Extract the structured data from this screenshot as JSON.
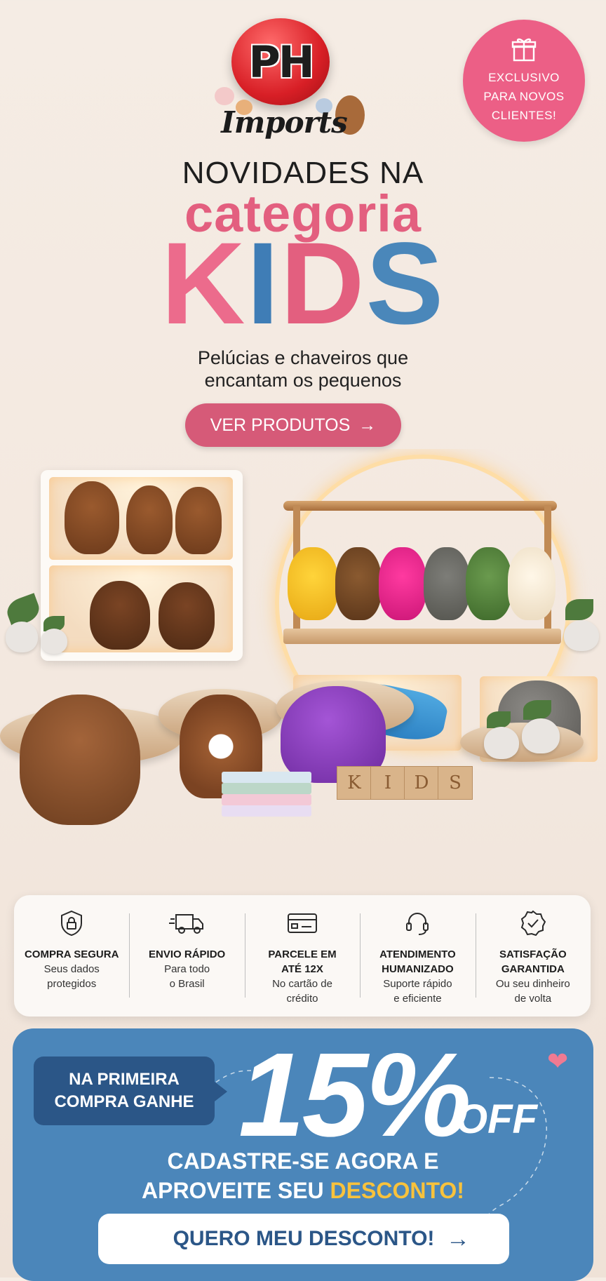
{
  "logo": {
    "letters": "PH",
    "wordmark": "Imports"
  },
  "badge": {
    "line1": "EXCLUSIVO",
    "line2": "PARA NOVOS",
    "line3": "CLIENTES!",
    "icon": "gift-icon"
  },
  "hero": {
    "line1": "NOVIDADES NA",
    "line2": "categoria",
    "kids_letters": [
      "K",
      "I",
      "D",
      "S"
    ],
    "subtitle_line1": "Pelúcias e chaveiros que",
    "subtitle_line2": "encantam os pequenos",
    "cta_label": "VER PRODUTOS",
    "cta_arrow": "→"
  },
  "scene": {
    "blocks_letters": [
      "K",
      "I",
      "D",
      "S"
    ]
  },
  "benefits": [
    {
      "icon": "shield-lock-icon",
      "title": "COMPRA SEGURA",
      "desc1": "Seus dados",
      "desc2": "protegidos"
    },
    {
      "icon": "truck-icon",
      "title": "ENVIO RÁPIDO",
      "desc1": "Para todo",
      "desc2": "o Brasil"
    },
    {
      "icon": "credit-card-icon",
      "title": "PARCELE EM",
      "title2": "ATÉ 12X",
      "desc1": "No cartão de",
      "desc2": "crédito"
    },
    {
      "icon": "headset-icon",
      "title": "ATENDIMENTO",
      "title2": "HUMANIZADO",
      "desc1": "Suporte rápido",
      "desc2": "e eficiente"
    },
    {
      "icon": "check-badge-icon",
      "title": "SATISFAÇÃO",
      "title2": "GARANTIDA",
      "desc1": "Ou seu dinheiro",
      "desc2": "de volta"
    }
  ],
  "promo": {
    "tag_line1": "NA PRIMEIRA",
    "tag_line2": "COMPRA GANHE",
    "percent": "15%",
    "off": "OFF",
    "cadastre_line1": "CADASTRE-SE AGORA E",
    "cadastre_line2a": "APROVEITE SEU ",
    "cadastre_highlight": "DESCONTO!",
    "button_label": "QUERO MEU DESCONTO!",
    "button_arrow": "→"
  },
  "colors": {
    "pink": "#e35f7f",
    "blue": "#4b86ba",
    "navy": "#2b5687",
    "yellow": "#f8c23c"
  }
}
